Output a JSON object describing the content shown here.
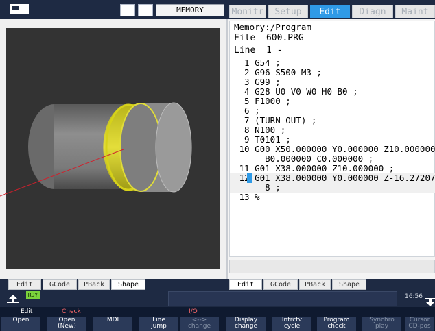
{
  "topbar": {
    "mode": "MEMORY",
    "tabs": [
      {
        "label": "Monitr",
        "active": false
      },
      {
        "label": "Setup",
        "active": false
      },
      {
        "label": "Edit",
        "active": true
      },
      {
        "label": "Diagn",
        "active": false
      },
      {
        "label": "Maint",
        "active": false
      }
    ]
  },
  "program": {
    "path": "Memory:/Program",
    "file_label": "File",
    "file_name": "600.PRG",
    "line_label": "Line",
    "line_value": "1 -",
    "lines": [
      "  1 G54 ;",
      "  2 G96 S500 M3 ;",
      "  3 G99 ;",
      "  4 G28 U0 V0 W0 H0 B0 ;",
      "  5 F1000 ;",
      "  6 ;",
      "  7 (TURN-OUT) ;",
      "  8 N100 ;",
      "  9 T0101 ;",
      " 10 G00 X50.000000 Y0.000000 Z10.000000",
      "      B0.000000 C0.000000 ;",
      " 11 G01 X38.000000 Z10.000000 ;",
      " 12 G01 X38.000000 Y0.000000 Z-16.27207",
      "      8 ;",
      " 13 %"
    ]
  },
  "left_tabs": [
    "Edit",
    "GCode",
    "PBack",
    "Shape"
  ],
  "right_tabs": [
    "Edit",
    "GCode",
    "PBack",
    "Shape"
  ],
  "status": {
    "ready": "RDY",
    "time": "16:56",
    "top_labels": [
      "Edit",
      "Check",
      "I/O"
    ]
  },
  "softkeys": [
    {
      "label": "Open",
      "enabled": true
    },
    {
      "label": "Open\n(New)",
      "enabled": true
    },
    {
      "label": "MDI",
      "enabled": true
    },
    {
      "label": "Line\njump",
      "enabled": true
    },
    {
      "label": "<-->\nchange",
      "enabled": false
    },
    {
      "label": "Display\nchange",
      "enabled": true
    },
    {
      "label": "Intrctv\ncycle",
      "enabled": true
    },
    {
      "label": "Program\ncheck",
      "enabled": true
    },
    {
      "label": "Synchro\nplay",
      "enabled": false
    },
    {
      "label": "Cursor\nCD-pos",
      "enabled": false
    }
  ],
  "colors": {
    "accent": "#2f9ae6",
    "highlight_ring": "#d6d21a",
    "callout": "#d0202c"
  }
}
